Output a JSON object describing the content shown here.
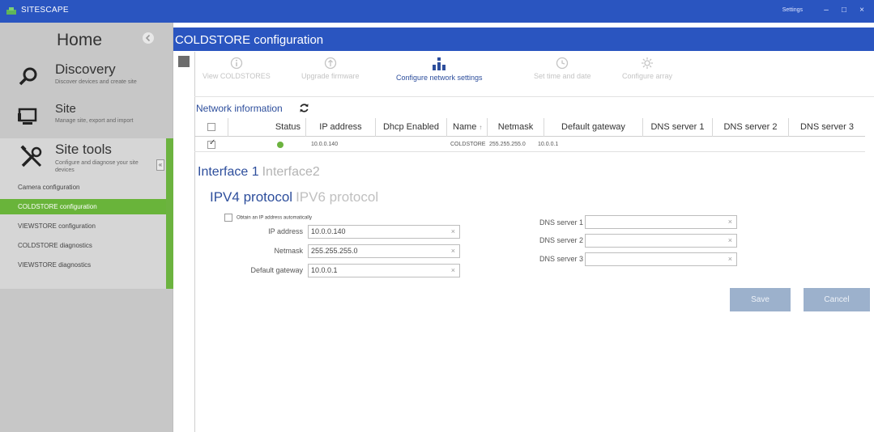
{
  "window": {
    "app_title": "SITESCAPE",
    "settings_label": "Settings",
    "minimize_glyph": "–",
    "maximize_glyph": "□",
    "close_glyph": "×"
  },
  "sidebar": {
    "home_label": "Home",
    "sections": [
      {
        "title": "Discovery",
        "description": "Discover devices and create site",
        "icon": "search-icon"
      },
      {
        "title": "Site",
        "description": "Manage site, export and import",
        "icon": "monitor-icon"
      },
      {
        "title": "Site tools",
        "description": "Configure and diagnose your site devices",
        "icon": "tools-icon"
      }
    ],
    "collapse_glyph": "«",
    "site_tools_items": [
      {
        "label": "Camera configuration",
        "active": false
      },
      {
        "label": "COLDSTORE configuration",
        "active": true
      },
      {
        "label": "VIEWSTORE configuration",
        "active": false
      },
      {
        "label": "COLDSTORE diagnostics",
        "active": false
      },
      {
        "label": "VIEWSTORE diagnostics",
        "active": false
      }
    ]
  },
  "header": {
    "title": "COLDSTORE configuration"
  },
  "toolbar": {
    "items": [
      {
        "label": "View COLDSTORES",
        "icon": "info-icon",
        "enabled": false
      },
      {
        "label": "Upgrade firmware",
        "icon": "upgrade-icon",
        "enabled": false
      },
      {
        "label": "Configure network settings",
        "icon": "network-icon",
        "enabled": true
      },
      {
        "label": "Set time and date",
        "icon": "clock-icon",
        "enabled": false
      },
      {
        "label": "Configure array",
        "icon": "gear-icon",
        "enabled": false
      }
    ]
  },
  "network_info": {
    "title": "Network information",
    "columns": [
      "Status",
      "IP address",
      "Dhcp Enabled",
      "Name",
      "Netmask",
      "Default gateway",
      "DNS server 1",
      "DNS server 2",
      "DNS server 3"
    ],
    "sort_glyph": "↑",
    "check_glyph": "✓",
    "rows": [
      {
        "checked": true,
        "status": "online",
        "ip": "10.0.0.140",
        "dhcp": "",
        "name": "COLDSTORE",
        "netmask": "255.255.255.0",
        "gateway": "10.0.0.1",
        "dns1": "",
        "dns2": "",
        "dns3": ""
      }
    ]
  },
  "interface_tabs": [
    "Interface 1",
    "Interface2"
  ],
  "protocol_tabs": [
    "IPV4 protocol",
    "IPV6 protocol"
  ],
  "ipv4": {
    "auto_ip_label": "Obtain an IP address automatically",
    "auto_ip_checked": false,
    "clear_glyph": "×",
    "ip_label": "IP address",
    "ip_value": "10.0.0.140",
    "netmask_label": "Netmask",
    "netmask_value": "255.255.255.0",
    "gateway_label": "Default gateway",
    "gateway_value": "10.0.0.1",
    "dns1_label": "DNS server 1",
    "dns1_value": "",
    "dns2_label": "DNS server 2",
    "dns2_value": "",
    "dns3_label": "DNS server 3",
    "dns3_value": ""
  },
  "actions": {
    "save_label": "Save",
    "cancel_label": "Cancel"
  },
  "colors": {
    "titlebar": "#2a55c0",
    "accent": "#2d4e9c",
    "active_green": "#6cb33f",
    "button": "#9cb1cc"
  }
}
